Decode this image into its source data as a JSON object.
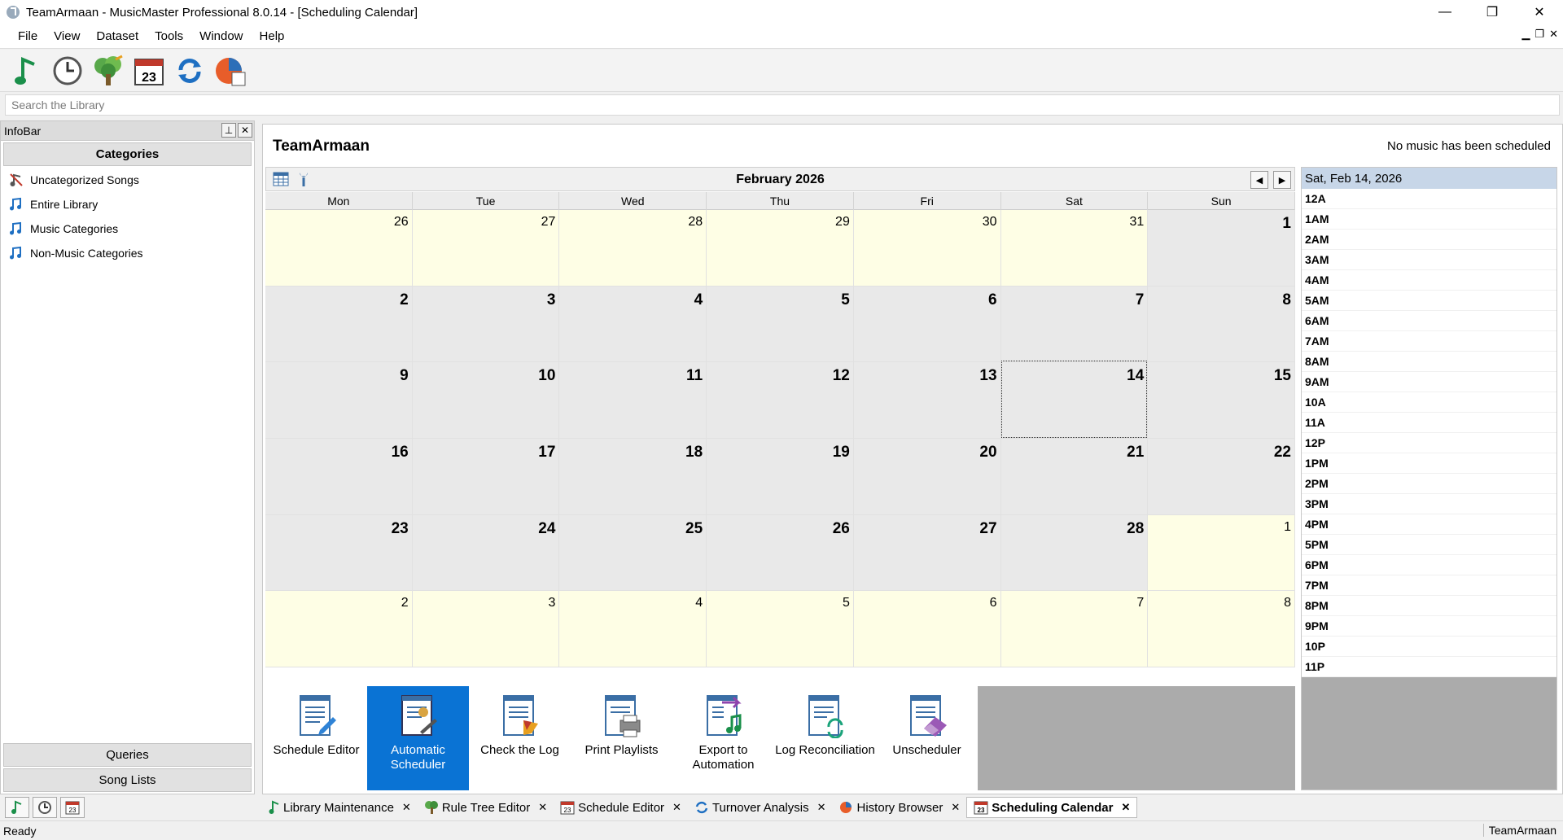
{
  "window": {
    "title": "TeamArmaan - MusicMaster Professional 8.0.14 - [Scheduling Calendar]",
    "minimize": "—",
    "maximize": "❐",
    "close": "✕"
  },
  "menu": {
    "items": [
      "File",
      "View",
      "Dataset",
      "Tools",
      "Window",
      "Help"
    ]
  },
  "search": {
    "placeholder": "Search the Library"
  },
  "infobar": {
    "title": "InfoBar",
    "categories_header": "Categories",
    "categories": [
      "Uncategorized Songs",
      "Entire Library",
      "Music Categories",
      "Non-Music Categories"
    ],
    "queries": "Queries",
    "song_lists": "Song Lists"
  },
  "main": {
    "title": "TeamArmaan",
    "status": "No music has been scheduled"
  },
  "calendar": {
    "month": "February 2026",
    "weekdays": [
      "Mon",
      "Tue",
      "Wed",
      "Thu",
      "Fri",
      "Sat",
      "Sun"
    ],
    "weeks": [
      [
        "26",
        "27",
        "28",
        "29",
        "30",
        "31",
        "1"
      ],
      [
        "2",
        "3",
        "4",
        "5",
        "6",
        "7",
        "8"
      ],
      [
        "9",
        "10",
        "11",
        "12",
        "13",
        "14",
        "15"
      ],
      [
        "16",
        "17",
        "18",
        "19",
        "20",
        "21",
        "22"
      ],
      [
        "23",
        "24",
        "25",
        "26",
        "27",
        "28",
        "1"
      ],
      [
        "2",
        "3",
        "4",
        "5",
        "6",
        "7",
        "8"
      ]
    ],
    "selected": "14"
  },
  "actions": [
    {
      "label": "Schedule Editor"
    },
    {
      "label": "Automatic Scheduler"
    },
    {
      "label": "Check the Log"
    },
    {
      "label": "Print Playlists"
    },
    {
      "label": "Export to Automation"
    },
    {
      "label": "Log Reconciliation"
    },
    {
      "label": "Unscheduler"
    }
  ],
  "day_panel": {
    "date": "Sat, Feb 14, 2026",
    "hours": [
      "12A",
      "1AM",
      "2AM",
      "3AM",
      "4AM",
      "5AM",
      "6AM",
      "7AM",
      "8AM",
      "9AM",
      "10A",
      "11A",
      "12P",
      "1PM",
      "2PM",
      "3PM",
      "4PM",
      "5PM",
      "6PM",
      "7PM",
      "8PM",
      "9PM",
      "10P",
      "11P"
    ]
  },
  "doc_tabs": [
    {
      "label": "Library Maintenance",
      "icon": "note-icon"
    },
    {
      "label": "Rule Tree Editor",
      "icon": "tree-icon"
    },
    {
      "label": "Schedule Editor",
      "icon": "calendar-icon"
    },
    {
      "label": "Turnover Analysis",
      "icon": "refresh-icon"
    },
    {
      "label": "History Browser",
      "icon": "chart-icon"
    },
    {
      "label": "Scheduling Calendar",
      "icon": "calendar-icon"
    }
  ],
  "status": {
    "left": "Ready",
    "right": "TeamArmaan"
  },
  "colors": {
    "accent": "#0a73d4",
    "other_month": "#fefee5",
    "month_day": "#e9e9e9"
  }
}
